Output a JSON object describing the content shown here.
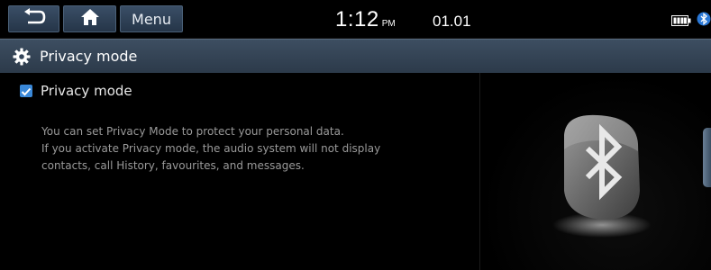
{
  "topbar": {
    "menu_label": "Menu",
    "time": "1:12",
    "ampm": "PM",
    "date": "01.01",
    "icons": [
      "back-arrow-icon",
      "home-icon",
      "battery-icon",
      "bluetooth-icon"
    ]
  },
  "titlebar": {
    "title": "Privacy mode",
    "icon": "gear-icon"
  },
  "content": {
    "checkbox_label": "Privacy mode",
    "checked": true,
    "description": [
      "You can set Privacy Mode to protect your personal data.",
      "If you activate Privacy mode, the audio system will not display",
      "contacts, call History, favourites, and messages."
    ]
  },
  "colors": {
    "button_bg": "#2f4156",
    "titlebar_bg": "#34455a",
    "checkbox": "#3a88d8",
    "description_text": "#9a9a9a"
  }
}
